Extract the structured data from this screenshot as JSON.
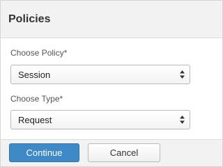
{
  "dialog": {
    "title": "Policies"
  },
  "policy_field": {
    "label": "Choose Policy*",
    "value": "Session"
  },
  "type_field": {
    "label": "Choose Type*",
    "value": "Request"
  },
  "footer": {
    "continue_label": "Continue",
    "cancel_label": "Cancel"
  },
  "colors": {
    "primary_button": "#3f8ac6",
    "header_bg": "#f2f2f2"
  },
  "icons": {
    "select_arrows": "chevron-up-down-icon"
  }
}
